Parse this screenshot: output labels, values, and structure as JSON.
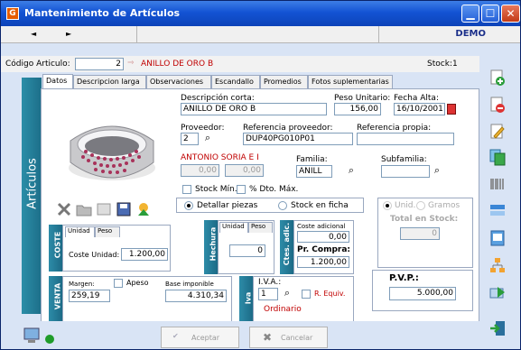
{
  "window": {
    "title": "Mantenimiento de Artículos",
    "app_icon": "G"
  },
  "nav": {
    "prev": "◄",
    "next": "►",
    "company": "DEMO"
  },
  "code": {
    "label": "Código Articulo:",
    "value": "2",
    "arrow": "⇒",
    "name": "ANILLO DE ORO B",
    "stock": "Stock:1"
  },
  "tabs": [
    "Datos",
    "Descripcion larga",
    "Observaciones",
    "Escandallo",
    "Promedios",
    "Fotos suplementarias"
  ],
  "side_title": "Artículos",
  "form": {
    "desc_corta_label": "Descripción corta:",
    "desc_corta": "ANILLO DE ORO B",
    "peso_label": "Peso Unitario:",
    "peso": "156,00",
    "fecha_label": "Fecha Alta:",
    "fecha": "16/10/2001",
    "prov_label": "Proveedor:",
    "prov": "2",
    "ref_prov_label": "Referencia proveedor:",
    "ref_prov": "DUP40PG010P01",
    "ref_propia_label": "Referencia propia:",
    "ref_propia": "",
    "prov_name": "ANTONIO SORIA E I",
    "val1": "0,00",
    "val2": "0,00",
    "familia_label": "Familia:",
    "familia": "ANILL",
    "subfamilia_label": "Subfamilia:",
    "subfamilia": "",
    "stock_min": "Stock Mín.",
    "dto_max": "% Dto. Máx.",
    "detallar": "Detallar piezas",
    "stock_ficha": "Stock en ficha",
    "unid": "Unid.",
    "gramos": "Gramos",
    "total_stock_label": "Total en Stock:",
    "total_stock": "0"
  },
  "coste": {
    "section": "COSTE",
    "unidad_tab": "Unidad",
    "peso_tab": "Peso",
    "coste_unidad_label": "Coste Unidad:",
    "coste_unidad": "1.200,00"
  },
  "hechura": {
    "section": "Hechura",
    "unidad_tab": "Unidad",
    "peso_tab": "Peso",
    "value": "0"
  },
  "ctes": {
    "section": "Ctes. adic.",
    "coste_adic_label": "Coste adicional",
    "coste_adic": "0,00",
    "pr_compra_label": "Pr. Compra:",
    "pr_compra": "1.200,00"
  },
  "venta": {
    "section": "VENTA",
    "margen_label": "Margen:",
    "margen": "259,19",
    "apeso": "Apeso",
    "base_label": "Base imponible",
    "base": "4.310,34"
  },
  "iva": {
    "section": "Iva",
    "label": "I.V.A.:",
    "value": "1",
    "r_equiv": "R. Equiv.",
    "tipo": "Ordinario"
  },
  "pvp": {
    "label": "P.V.P.:",
    "value": "5.000,00"
  },
  "footer": {
    "aceptar": "Aceptar",
    "cancelar": "Cancelar"
  },
  "colors": {
    "title_bar": "#1353d4",
    "accent": "#1d6e89",
    "red_text": "#c00000"
  }
}
